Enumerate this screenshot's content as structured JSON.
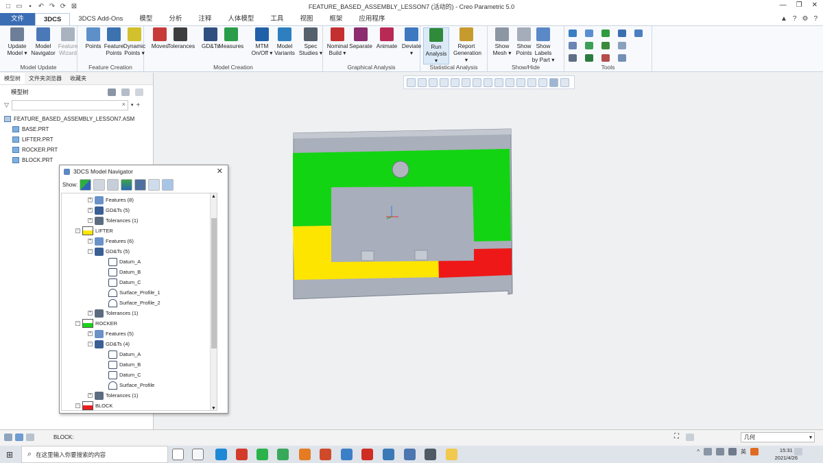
{
  "window": {
    "title": "FEATURE_BASED_ASSEMBLY_LESSON7 (活动的) - Creo Parametric 5.0",
    "controls": [
      "—",
      "❐",
      "✕"
    ],
    "tab_right_icons": [
      "▲",
      "?",
      "⚙",
      "?"
    ]
  },
  "tabs": [
    {
      "label": "文件"
    },
    {
      "label": "3DCS"
    },
    {
      "label": "3DCS Add-Ons"
    },
    {
      "label": "模型"
    },
    {
      "label": "分析"
    },
    {
      "label": "注释"
    },
    {
      "label": "人体模型"
    },
    {
      "label": "工具"
    },
    {
      "label": "视图"
    },
    {
      "label": "框架"
    },
    {
      "label": "应用程序"
    }
  ],
  "ribbon": {
    "groups": [
      {
        "label": "Model Update",
        "buttons": [
          {
            "l1": "Update",
            "l2": "Model ▾",
            "icon": "update-model-icon",
            "color": "#6d7f98"
          },
          {
            "l1": "Model",
            "l2": "Navigator",
            "icon": "model-navigator-icon",
            "color": "#4a78b8"
          },
          {
            "l1": "Feature",
            "l2": "Wizard",
            "icon": "feature-wizard-icon",
            "color": "#a9b3bf"
          }
        ]
      },
      {
        "label": "Feature Creation",
        "buttons": [
          {
            "l1": "Points",
            "l2": "",
            "icon": "points-icon",
            "color": "#5d8fc8"
          },
          {
            "l1": "Feature",
            "l2": "Points",
            "icon": "feature-points-icon",
            "color": "#3c72b0"
          },
          {
            "l1": "Dynamic",
            "l2": "Points ▾",
            "icon": "dynamic-points-icon",
            "color": "#d2c02c"
          }
        ]
      },
      {
        "label": "Model Creation",
        "buttons": [
          {
            "l1": "Moves",
            "l2": "",
            "icon": "moves-icon",
            "color": "#c83a3a"
          },
          {
            "l1": "Tolerances",
            "l2": "",
            "icon": "tolerances-icon",
            "color": "#3d3d3d"
          },
          {
            "l1": "GD&Ts",
            "l2": "",
            "icon": "gdts-icon",
            "color": "#2f4f80"
          },
          {
            "l1": "Measures",
            "l2": "",
            "icon": "measures-icon",
            "color": "#2a9d4a"
          },
          {
            "l1": "MTM",
            "l2": "On/Off ▾",
            "icon": "mtm-icon",
            "color": "#2060a8"
          },
          {
            "l1": "Model",
            "l2": "Variants",
            "icon": "model-variants-icon",
            "color": "#2e7fbf"
          },
          {
            "l1": "Spec",
            "l2": "Studies ▾",
            "icon": "spec-studies-icon",
            "color": "#55606d"
          }
        ]
      },
      {
        "label": "Graphical Analysis",
        "buttons": [
          {
            "l1": "Nominal",
            "l2": "Build ▾",
            "icon": "nominal-build-icon",
            "color": "#c43030"
          },
          {
            "l1": "Separate",
            "l2": "",
            "icon": "separate-icon",
            "color": "#8b2d6e"
          },
          {
            "l1": "Animate",
            "l2": "",
            "icon": "animate-icon",
            "color": "#b82a55"
          },
          {
            "l1": "Deviate",
            "l2": "▾",
            "icon": "deviate-icon",
            "color": "#3e78c0"
          }
        ]
      },
      {
        "label": "Statistical Analysis",
        "buttons": [
          {
            "l1": "Run",
            "l2": "Analysis ▾",
            "icon": "run-analysis-icon",
            "color": "#2f8a3a"
          },
          {
            "l1": "Report",
            "l2": "Generation ▾",
            "icon": "report-generation-icon",
            "color": "#c79a2e"
          }
        ]
      },
      {
        "label": "Show/Hide",
        "buttons": [
          {
            "l1": "Show",
            "l2": "Mesh ▾",
            "icon": "show-mesh-icon",
            "color": "#8d96a3"
          },
          {
            "l1": "Show",
            "l2": "Points",
            "icon": "show-points-icon",
            "color": "#a4adb9"
          },
          {
            "l1": "Show Labels",
            "l2": "by Part ▾",
            "icon": "show-labels-icon",
            "color": "#5b88c6"
          }
        ]
      },
      {
        "label": "Tools",
        "buttons": []
      }
    ]
  },
  "left_panel": {
    "tabs": [
      "模型树",
      "文件夹浏览器",
      "收藏夹"
    ],
    "heading": "模型树",
    "search_value": "",
    "clear_glyph": "×",
    "add_glyph": "+",
    "root": "FEATURE_BASED_ASSEMBLY_LESSON7.ASM",
    "parts": [
      "BASE.PRT",
      "LIFTER.PRT",
      "ROCKER.PRT",
      "BLOCK.PRT"
    ]
  },
  "navigator": {
    "title": "3DCS Model Navigator",
    "close": "✕",
    "show_label": "Show:",
    "rows": [
      {
        "label": "Features (8)",
        "kind": "feat"
      },
      {
        "label": "GD&Ts (5)",
        "kind": "gdt"
      },
      {
        "label": "Tolerances (1)",
        "kind": "tol"
      },
      {
        "label": "LIFTER",
        "kind": "part",
        "color": "#ffe600"
      },
      {
        "label": "Features (6)",
        "kind": "feat"
      },
      {
        "label": "GD&Ts (5)",
        "kind": "gdt"
      },
      {
        "label": "Datum_A",
        "kind": "datum"
      },
      {
        "label": "Datum_B",
        "kind": "datum"
      },
      {
        "label": "Datum_C",
        "kind": "datum"
      },
      {
        "label": "Surface_Profile_1",
        "kind": "profile"
      },
      {
        "label": "Surface_Profile_2",
        "kind": "profile"
      },
      {
        "label": "Tolerances (1)",
        "kind": "tol"
      },
      {
        "label": "ROCKER",
        "kind": "part",
        "color": "#19d419"
      },
      {
        "label": "Features (5)",
        "kind": "feat"
      },
      {
        "label": "GD&Ts (4)",
        "kind": "gdt"
      },
      {
        "label": "Datum_A",
        "kind": "datum"
      },
      {
        "label": "Datum_B",
        "kind": "datum"
      },
      {
        "label": "Datum_C",
        "kind": "datum"
      },
      {
        "label": "Surface_Profile",
        "kind": "profile"
      },
      {
        "label": "Tolerances (1)",
        "kind": "tol"
      },
      {
        "label": "BLOCK",
        "kind": "part",
        "color": "#ee1c1c"
      }
    ]
  },
  "model_colors": {
    "base": "#a9afbb",
    "rocker": "#13d413",
    "lifter": "#fde500",
    "block": "#ee1818"
  },
  "status": {
    "selection": "BLOCK:",
    "filter": "几何"
  },
  "taskbar": {
    "start": "⊞",
    "search_icon": "⌕",
    "search_placeholder": "在这里输入你要搜索的内容",
    "tray": [
      "^",
      "英"
    ],
    "time": "15:31",
    "date": "2021/4/26"
  }
}
